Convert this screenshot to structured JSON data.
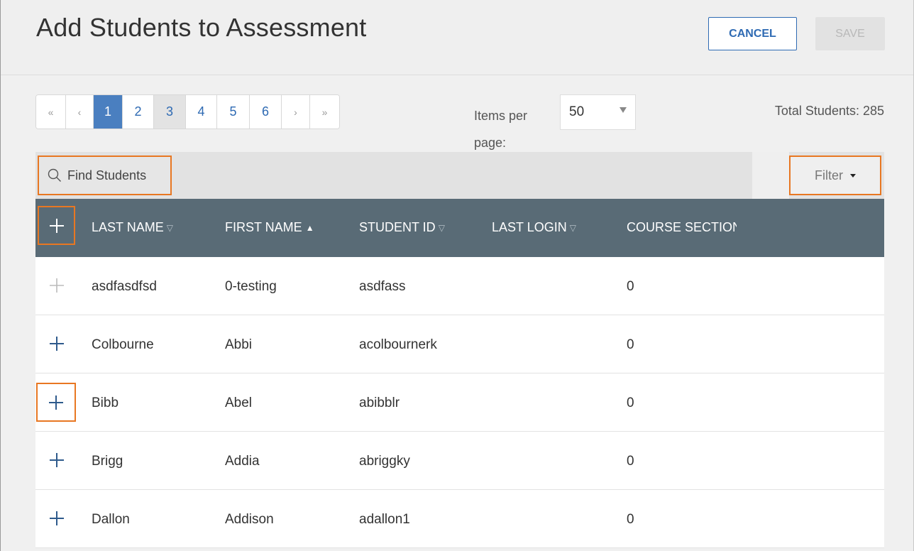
{
  "header": {
    "title": "Add Students to Assessment",
    "cancel_label": "CANCEL",
    "save_label": "SAVE"
  },
  "pagination": {
    "first": "«",
    "prev": "‹",
    "pages": [
      "1",
      "2",
      "3",
      "4",
      "5",
      "6"
    ],
    "active_page": "1",
    "next": "›",
    "last": "»"
  },
  "items_per_page": {
    "label": "Items per page:",
    "value": "50"
  },
  "total_students": "Total Students: 285",
  "search": {
    "placeholder": "Find Students",
    "icon": "search-icon"
  },
  "filter": {
    "label": "Filter"
  },
  "table": {
    "columns": [
      {
        "label": "LAST NAME",
        "sort": "unsorted"
      },
      {
        "label": "FIRST NAME",
        "sort": "ascending"
      },
      {
        "label": "STUDENT ID",
        "sort": "unsorted"
      },
      {
        "label": "LAST LOGIN",
        "sort": "unsorted"
      },
      {
        "label": "COURSE SECTION:",
        "sort": "none"
      }
    ],
    "rows": [
      {
        "last": "asdfasdfsd",
        "first": "0-testing",
        "id": "asdfass",
        "login": "",
        "sections": "0",
        "add_enabled": false
      },
      {
        "last": "Colbourne",
        "first": "Abbi",
        "id": "acolbournerk",
        "login": "",
        "sections": "0",
        "add_enabled": true
      },
      {
        "last": "Bibb",
        "first": "Abel",
        "id": "abibblr",
        "login": "",
        "sections": "0",
        "add_enabled": true
      },
      {
        "last": "Brigg",
        "first": "Addia",
        "id": "abriggky",
        "login": "",
        "sections": "0",
        "add_enabled": true
      },
      {
        "last": "Dallon",
        "first": "Addison",
        "id": "adallon1",
        "login": "",
        "sections": "0",
        "add_enabled": true
      }
    ]
  },
  "colors": {
    "accent": "#2e6ab3",
    "highlight": "#e87722",
    "table_header": "#596b76",
    "active_page": "#4a7fc0"
  }
}
